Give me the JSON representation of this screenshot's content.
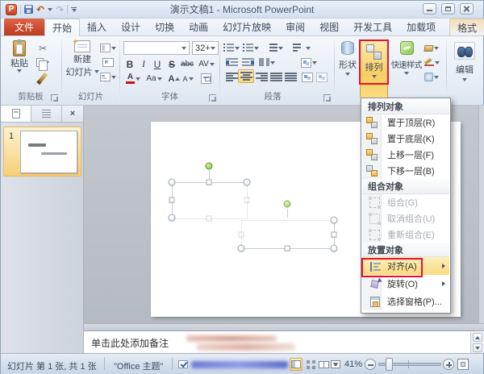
{
  "titlebar": {
    "app_letter": "P",
    "title": "演示文稿1 - Microsoft PowerPoint",
    "help_glyph": "?"
  },
  "icons": {
    "scissors": "✂",
    "undo": "↶",
    "redo": "↷",
    "close": "×"
  },
  "tabs": {
    "file": "文件",
    "home": "开始",
    "insert": "插入",
    "design": "设计",
    "transitions": "切换",
    "animations": "动画",
    "slideshow": "幻灯片放映",
    "review": "审阅",
    "view": "视图",
    "developer": "开发工具",
    "addins": "加载项",
    "format": "格式"
  },
  "ribbon": {
    "clipboard": {
      "paste": "粘贴",
      "group_label": "剪贴板"
    },
    "slides": {
      "new_slide_1": "新建",
      "new_slide_2": "幻灯片",
      "group_label": "幻灯片"
    },
    "font": {
      "size_value": "32+",
      "bold": "B",
      "italic": "I",
      "underline": "U",
      "strike": "S",
      "strikethrough_glyph": "abc",
      "spacing_glyph": "AV",
      "font_color_glyph": "A",
      "change_case_glyph": "Aa",
      "grow_glyph": "A",
      "shrink_glyph": "A",
      "group_label": "字体"
    },
    "paragraph": {
      "group_label": "段落"
    },
    "drawing": {
      "shapes": "形状",
      "arrange": "排列",
      "quick_styles": "快速样式"
    },
    "editing": {
      "label": "编辑"
    }
  },
  "arrange_menu": {
    "header_arrange": "排列对象",
    "bring_to_front": "置于顶层(R)",
    "send_to_back": "置于底层(K)",
    "bring_forward": "上移一层(F)",
    "send_backward": "下移一层(B)",
    "header_group": "组合对象",
    "group": "组合(G)",
    "ungroup": "取消组合(U)",
    "regroup": "重新组合(E)",
    "header_position": "放置对象",
    "align": "对齐(A)",
    "rotate": "旋转(O)",
    "selection_pane": "选择窗格(P)..."
  },
  "slides_panel": {
    "slide_number": "1"
  },
  "notes": {
    "placeholder": "单击此处添加备注"
  },
  "status_bar": {
    "slide_info": "幻灯片 第 1 张, 共 1 张",
    "theme": "\"Office 主题\"",
    "zoom_level": "41%"
  },
  "colors": {
    "annotation_red": "#e8112d",
    "pressed_orange": "#f7ce63",
    "file_tab_orange": "#c8402a"
  }
}
